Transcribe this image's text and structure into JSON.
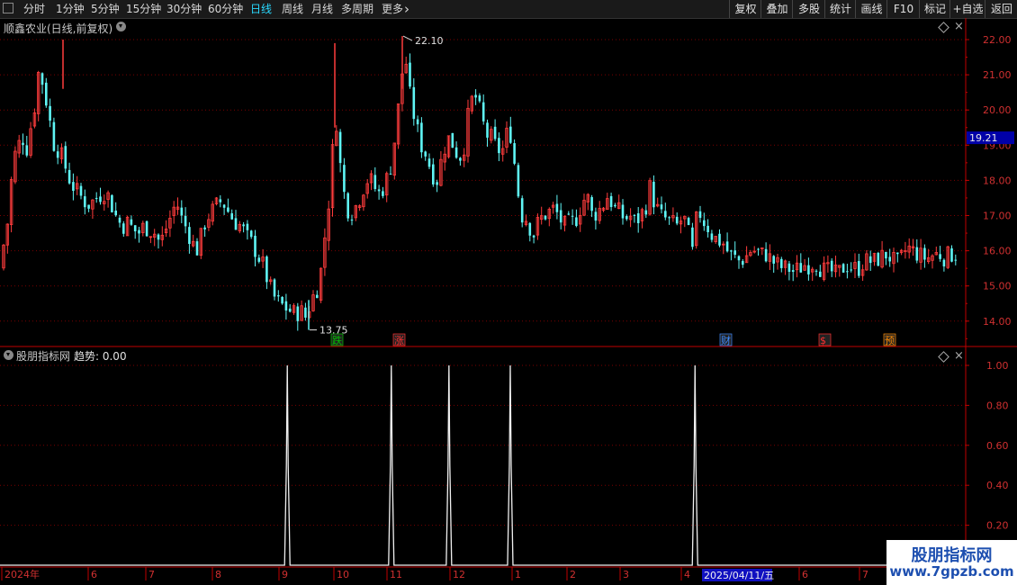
{
  "toolbar": {
    "periods": [
      {
        "label": "分时",
        "active": false
      },
      {
        "label": "1分钟",
        "active": false
      },
      {
        "label": "5分钟",
        "active": false
      },
      {
        "label": "15分钟",
        "active": false
      },
      {
        "label": "30分钟",
        "active": false
      },
      {
        "label": "60分钟",
        "active": false
      },
      {
        "label": "日线",
        "active": true
      },
      {
        "label": "周线",
        "active": false
      },
      {
        "label": "月线",
        "active": false
      },
      {
        "label": "多周期",
        "active": false
      },
      {
        "label": "更多",
        "active": false
      }
    ],
    "more_icon": "chevron-right-icon",
    "right_buttons": [
      "复权",
      "叠加",
      "多股",
      "统计",
      "画线",
      "F10",
      "标记",
      "+自选",
      "返回"
    ]
  },
  "main_chart": {
    "title": "顺鑫农业(日线,前复权)",
    "y_ticks": [
      "22.00",
      "21.00",
      "20.00",
      "19.00",
      "18.00",
      "17.00",
      "16.00",
      "15.00",
      "14.00"
    ],
    "current_price": "19.21",
    "high_label": "22.10",
    "low_label": "13.75",
    "event_tags": [
      {
        "text": "跌",
        "color": "#00c000"
      },
      {
        "text": "涨",
        "color": "#ff3030"
      },
      {
        "text": "财",
        "color": "#3d8bff"
      },
      {
        "text": "$",
        "color": "#ff3030"
      },
      {
        "text": "预",
        "color": "#ff8c00"
      }
    ]
  },
  "indicator": {
    "name": "股朋指标网",
    "series_label": "趋势: 0.00",
    "y_ticks": [
      "1.00",
      "0.80",
      "0.60",
      "0.40",
      "0.20"
    ]
  },
  "time_axis": {
    "labels": [
      "2024年",
      "6",
      "7",
      "8",
      "9",
      "10",
      "11",
      "12",
      "1",
      "2",
      "3",
      "4",
      "6",
      "7"
    ],
    "cursor_date": "2025/04/11/五"
  },
  "watermark": {
    "line1": "股朋指标网",
    "line2": "www.7gpzb.com"
  },
  "colors": {
    "up": "#ff3c3c",
    "down": "#5ff5f5",
    "accent": "#29d9ff",
    "grid": "#7a0000",
    "axis": "#c00000"
  },
  "chart_data": [
    {
      "type": "candlestick",
      "title": "顺鑫农业(日线,前复权)",
      "y_axis_ticks": [
        14,
        15,
        16,
        17,
        18,
        19,
        20,
        21,
        22
      ],
      "ylim": [
        13.4,
        22.3
      ],
      "high": 22.1,
      "low": 13.75,
      "last_price": 19.21,
      "x_labels": [
        "2024年",
        "6",
        "7",
        "8",
        "9",
        "10",
        "11",
        "12",
        "1",
        "2",
        "3",
        "4",
        "6",
        "7"
      ],
      "note_path_close": [
        [
          0,
          15.5
        ],
        [
          6,
          16.5
        ],
        [
          10,
          17.0
        ],
        [
          14,
          18.5
        ],
        [
          20,
          19.0
        ],
        [
          26,
          19.2
        ],
        [
          30,
          18.9
        ],
        [
          36,
          19.8
        ],
        [
          40,
          20.3
        ],
        [
          44,
          21.4
        ],
        [
          48,
          20.6
        ],
        [
          54,
          20.0
        ],
        [
          58,
          19.1
        ],
        [
          64,
          18.9
        ],
        [
          70,
          18.6
        ],
        [
          76,
          18.1
        ],
        [
          82,
          17.8
        ],
        [
          88,
          17.6
        ],
        [
          94,
          17.4
        ],
        [
          100,
          17.3
        ],
        [
          106,
          17.5
        ],
        [
          112,
          17.6
        ],
        [
          118,
          17.7
        ],
        [
          124,
          17.3
        ],
        [
          130,
          16.9
        ],
        [
          136,
          16.7
        ],
        [
          142,
          16.8
        ],
        [
          148,
          16.6
        ],
        [
          154,
          16.5
        ],
        [
          160,
          16.7
        ],
        [
          166,
          16.6
        ],
        [
          172,
          16.5
        ],
        [
          178,
          16.2
        ],
        [
          184,
          16.6
        ],
        [
          190,
          17.0
        ],
        [
          196,
          17.4
        ],
        [
          202,
          16.9
        ],
        [
          208,
          16.6
        ],
        [
          214,
          16.2
        ],
        [
          220,
          16.0
        ],
        [
          226,
          16.7
        ],
        [
          232,
          17.0
        ],
        [
          238,
          17.2
        ],
        [
          244,
          17.4
        ],
        [
          250,
          17.3
        ],
        [
          256,
          17.0
        ],
        [
          262,
          16.8
        ],
        [
          268,
          16.7
        ],
        [
          274,
          16.4
        ],
        [
          280,
          16.2
        ],
        [
          286,
          15.9
        ],
        [
          292,
          15.6
        ],
        [
          298,
          15.1
        ],
        [
          304,
          14.7
        ],
        [
          310,
          14.5
        ],
        [
          316,
          14.4
        ],
        [
          322,
          14.3
        ],
        [
          328,
          14.2
        ],
        [
          334,
          14.3
        ],
        [
          340,
          14.1
        ],
        [
          346,
          14.6
        ],
        [
          352,
          14.9
        ],
        [
          356,
          15.3
        ],
        [
          360,
          16.2
        ],
        [
          364,
          17.1
        ],
        [
          368,
          18.0
        ],
        [
          372,
          20.2
        ],
        [
          376,
          19.0
        ],
        [
          380,
          17.9
        ],
        [
          386,
          17.2
        ],
        [
          392,
          17.1
        ],
        [
          398,
          17.4
        ],
        [
          404,
          17.8
        ],
        [
          410,
          18.1
        ],
        [
          416,
          17.8
        ],
        [
          422,
          17.6
        ],
        [
          428,
          17.9
        ],
        [
          434,
          18.4
        ],
        [
          440,
          19.4
        ],
        [
          446,
          20.9
        ],
        [
          450,
          21.6
        ],
        [
          456,
          20.3
        ],
        [
          462,
          19.6
        ],
        [
          468,
          19.0
        ],
        [
          474,
          18.7
        ],
        [
          480,
          18.2
        ],
        [
          486,
          18.0
        ],
        [
          492,
          18.8
        ],
        [
          498,
          19.2
        ],
        [
          504,
          19.0
        ],
        [
          510,
          18.6
        ],
        [
          516,
          19.0
        ],
        [
          522,
          20.2
        ],
        [
          528,
          20.4
        ],
        [
          534,
          19.9
        ],
        [
          540,
          19.3
        ],
        [
          546,
          19.2
        ],
        [
          552,
          18.9
        ],
        [
          558,
          18.8
        ],
        [
          564,
          19.4
        ],
        [
          568,
          19.3
        ],
        [
          572,
          18.4
        ],
        [
          576,
          17.6
        ],
        [
          580,
          17.0
        ],
        [
          586,
          16.9
        ],
        [
          592,
          16.4
        ],
        [
          598,
          16.8
        ],
        [
          604,
          17.0
        ],
        [
          610,
          17.1
        ],
        [
          616,
          17.2
        ],
        [
          622,
          16.9
        ],
        [
          628,
          16.7
        ],
        [
          634,
          16.8
        ],
        [
          640,
          16.9
        ],
        [
          646,
          17.3
        ],
        [
          652,
          17.6
        ],
        [
          658,
          17.0
        ],
        [
          664,
          17.1
        ],
        [
          670,
          17.3
        ],
        [
          676,
          17.6
        ],
        [
          682,
          17.2
        ],
        [
          688,
          17.1
        ],
        [
          694,
          16.9
        ],
        [
          700,
          17.0
        ],
        [
          706,
          16.8
        ],
        [
          712,
          17.0
        ],
        [
          718,
          17.3
        ],
        [
          722,
          17.8
        ],
        [
          728,
          17.3
        ],
        [
          734,
          17.0
        ],
        [
          740,
          16.9
        ],
        [
          746,
          16.8
        ],
        [
          752,
          16.7
        ],
        [
          758,
          16.9
        ],
        [
          764,
          16.8
        ],
        [
          768,
          15.6
        ],
        [
          772,
          16.6
        ],
        [
          776,
          17.2
        ],
        [
          780,
          16.9
        ],
        [
          786,
          16.7
        ],
        [
          792,
          16.4
        ],
        [
          798,
          16.3
        ],
        [
          804,
          16.2
        ],
        [
          810,
          15.9
        ],
        [
          816,
          15.8
        ],
        [
          822,
          15.7
        ],
        [
          828,
          15.8
        ],
        [
          834,
          16.0
        ],
        [
          840,
          16.0
        ],
        [
          846,
          15.9
        ],
        [
          852,
          15.9
        ],
        [
          858,
          15.7
        ],
        [
          864,
          15.6
        ],
        [
          870,
          15.5
        ],
        [
          876,
          15.5
        ],
        [
          882,
          15.4
        ],
        [
          888,
          15.5
        ],
        [
          894,
          15.6
        ],
        [
          900,
          15.6
        ],
        [
          906,
          15.7
        ],
        [
          912,
          15.5
        ],
        [
          918,
          15.4
        ],
        [
          924,
          15.4
        ],
        [
          930,
          15.3
        ],
        [
          936,
          15.5
        ],
        [
          942,
          15.6
        ],
        [
          948,
          15.5
        ],
        [
          954,
          15.5
        ],
        [
          960,
          15.7
        ],
        [
          966,
          15.7
        ],
        [
          972,
          15.7
        ],
        [
          978,
          15.8
        ],
        [
          984,
          15.9
        ],
        [
          990,
          15.8
        ],
        [
          996,
          15.6
        ],
        [
          1002,
          15.8
        ],
        [
          1008,
          16.1
        ],
        [
          1014,
          16.0
        ],
        [
          1020,
          15.9
        ],
        [
          1026,
          15.8
        ],
        [
          1032,
          15.8
        ],
        [
          1038,
          15.9
        ],
        [
          1044,
          15.9
        ],
        [
          1050,
          15.8
        ],
        [
          1056,
          15.9
        ],
        [
          1062,
          15.9
        ]
      ]
    },
    {
      "type": "line",
      "name": "趋势",
      "ylim": [
        0,
        1.1
      ],
      "y_axis_ticks": [
        0.2,
        0.4,
        0.6,
        0.8,
        1.0
      ],
      "baseline": 0,
      "spikes": [
        {
          "position_ratio": 0.2947,
          "value": 1.0
        },
        {
          "position_ratio": 0.4024,
          "value": 1.0
        },
        {
          "position_ratio": 0.4621,
          "value": 1.0
        },
        {
          "position_ratio": 0.5256,
          "value": 1.0
        },
        {
          "position_ratio": 0.7169,
          "value": 1.0
        }
      ],
      "current_value": 0.0
    }
  ]
}
